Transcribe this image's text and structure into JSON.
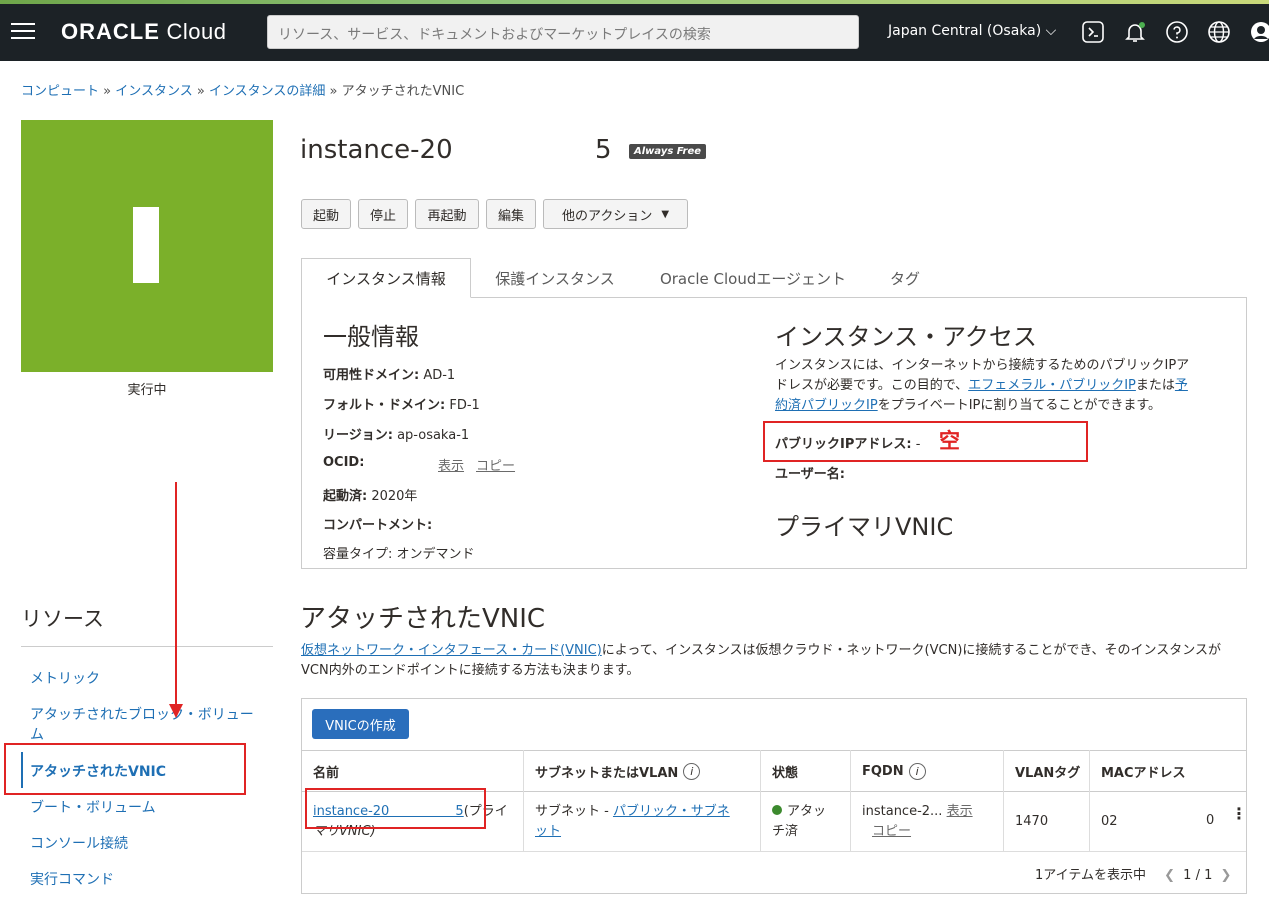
{
  "header": {
    "logo_brand": "ORACLE",
    "logo_product": " Cloud",
    "search_placeholder": "リソース、サービス、ドキュメントおよびマーケットプレイスの検索",
    "region": "Japan Central (Osaka)",
    "icons": [
      "menu-icon",
      "cloud-shell-icon",
      "bell-icon",
      "help-icon",
      "globe-icon",
      "user-icon"
    ]
  },
  "breadcrumb": {
    "items": [
      "コンピュート",
      "インスタンス",
      "インスタンスの詳細"
    ],
    "separator": " » ",
    "current": "アタッチされたVNIC"
  },
  "instance": {
    "tile_color": "#7bb02a",
    "status": "実行中",
    "name_prefix": "instance-20",
    "name_suffix": "5",
    "badge": "Always Free"
  },
  "actions": {
    "start": "起動",
    "stop": "停止",
    "reboot": "再起動",
    "edit": "編集",
    "more": "他のアクション"
  },
  "tabs": [
    "インスタンス情報",
    "保護インスタンス",
    "Oracle Cloudエージェント",
    "タグ"
  ],
  "general": {
    "heading": "一般情報",
    "ad_label": "可用性ドメイン:",
    "ad_value": " AD-1",
    "fd_label": "フォルト・ドメイン:",
    "fd_value": " FD-1",
    "region_label": "リージョン:",
    "region_value": " ap-osaka-1",
    "ocid_label": "OCID:",
    "ocid_show": "表示",
    "ocid_copy": "コピー",
    "launched_label": "起動済:",
    "launched_value": " 2020年",
    "compartment_label": "コンパートメント:",
    "capacity_partial": "容量タイプ: オンデマンド"
  },
  "access": {
    "heading": "インスタンス・アクセス",
    "desc_1": "インスタンスには、インターネットから接続するためのパブリックIPア",
    "desc_2": "ドレスが必要です。この目的で、",
    "link_ephemeral": "エフェメラル・パブリックIP",
    "desc_3": "または",
    "link_reserved_1": "予",
    "link_reserved_2": "約済パブリックIP",
    "desc_4": "をプライベートIPに割り当てることができます。",
    "public_ip_label": "パブリックIPアドレス:",
    "public_ip_value": " -",
    "annotation": "空",
    "username_label": "ユーザー名:",
    "primary_vnic": "プライマリVNIC"
  },
  "resources": {
    "title": "リソース",
    "items": [
      "メトリック",
      "アタッチされたブロック・ボリューム",
      "アタッチされたVNIC",
      "ブート・ボリューム",
      "コンソール接続",
      "実行コマンド"
    ]
  },
  "vnic_section": {
    "title": "アタッチされたVNIC",
    "desc_link": "仮想ネットワーク・インタフェース・カード(VNIC)",
    "desc_text": "によって、インスタンスは仮想クラウド・ネットワーク(VCN)に接続することができ、そのインスタンスがVCN内外のエンドポイントに接続する方法も決まります。",
    "create_button": "VNICの作成",
    "columns": [
      "名前",
      "サブネットまたはVLAN",
      "状態",
      "FQDN",
      "VLANタグ",
      "MACアドレス"
    ],
    "row": {
      "name_link": "instance-20                5",
      "name_suffix": "(プライ",
      "name_line2": "マリVNIC)",
      "subnet_prefix": "サブネット - ",
      "subnet_link_1": "パブリック・サブネ",
      "subnet_link_2": "ット",
      "state_1": "アタッ",
      "state_2": "チ済",
      "fqdn": "instance-2...",
      "fqdn_show": "表示",
      "fqdn_copy": "コピー",
      "vlan_tag": "1470",
      "mac": "02",
      "mac_end": "0"
    },
    "pagination_text": "1アイテムを表示中",
    "pagination_page": "1 / 1"
  },
  "colors": {
    "link": "#1e6fb4",
    "annotation_red": "#e02424",
    "primary_button": "#2a6ebc",
    "topbar": "#1c2226",
    "status_green": "#3c8a2e"
  }
}
